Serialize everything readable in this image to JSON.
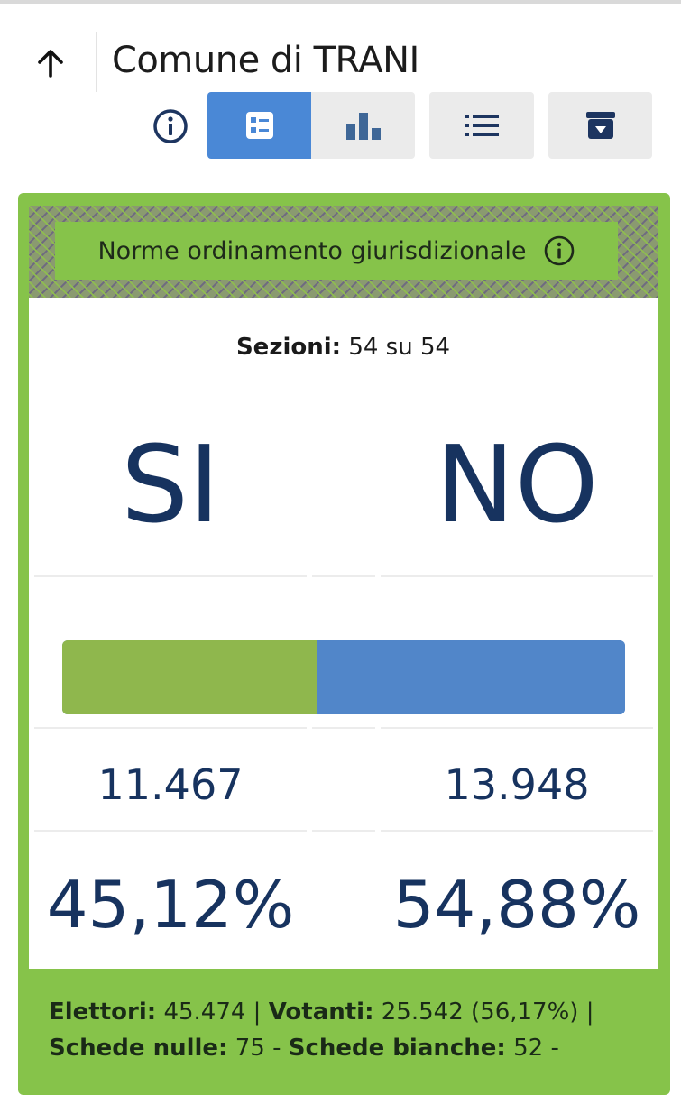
{
  "header": {
    "title": "Comune di TRANI"
  },
  "icons": {
    "back": "arrow-up-icon",
    "info": "info-circle-icon",
    "summary": "summary-list-icon",
    "chart": "bar-chart-icon",
    "list": "list-icon",
    "download": "archive-download-icon"
  },
  "card": {
    "title": "Norme ordinamento giurisdizionale",
    "sezioni_label": "Sezioni:",
    "sezioni_value": "54 su 54",
    "answers": {
      "si": "SI",
      "no": "NO"
    },
    "votes": {
      "si": "11.467",
      "no": "13.948"
    },
    "percent": {
      "si": "45,12%",
      "no": "54,88%"
    },
    "bar_share": {
      "si": 0.4512,
      "no": 0.5488
    }
  },
  "footer": {
    "elettori_label": "Elettori:",
    "elettori_value": "45.474 |",
    "votanti_label": "Votanti:",
    "votanti_value": "25.542 (56,17%) |",
    "nulle_label": "Schede nulle:",
    "nulle_value": "75 -",
    "bianche_label": "Schede bianche:",
    "bianche_value": "52 -"
  },
  "colors": {
    "accent_blue": "#4a88d6",
    "card_green": "#86c34a",
    "bar_si": "#8fb74d",
    "bar_no": "#5186c9",
    "text_navy": "#17335f"
  }
}
